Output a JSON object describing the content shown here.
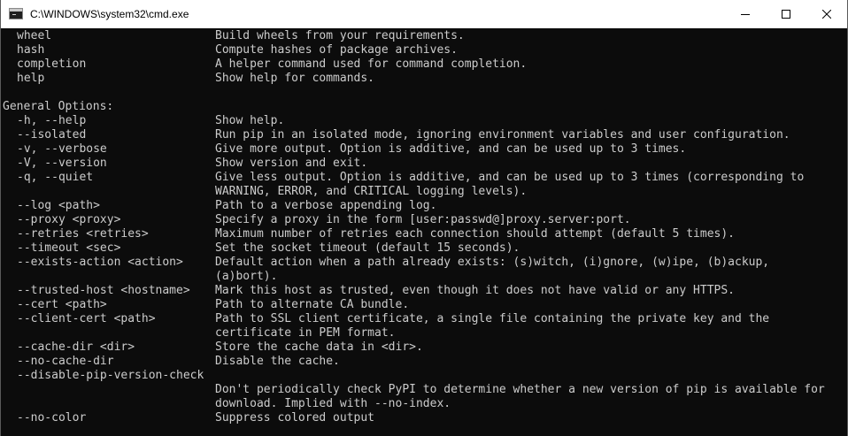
{
  "window": {
    "title": "C:\\WINDOWS\\system32\\cmd.exe",
    "icon": "console-icon",
    "minimize_icon": "minimize-icon",
    "maximize_icon": "maximize-icon",
    "close_icon": "close-icon"
  },
  "colors": {
    "console_bg": "#0c0c0c",
    "console_fg": "#cccccc",
    "titlebar_bg": "#ffffff"
  },
  "console": {
    "commands": [
      {
        "name": "wheel",
        "desc": "Build wheels from your requirements."
      },
      {
        "name": "hash",
        "desc": "Compute hashes of package archives."
      },
      {
        "name": "completion",
        "desc": "A helper command used for command completion."
      },
      {
        "name": "help",
        "desc": "Show help for commands."
      }
    ],
    "general_heading": "General Options:",
    "options": [
      {
        "opt": "-h, --help",
        "desc": [
          "Show help."
        ]
      },
      {
        "opt": "--isolated",
        "desc": [
          "Run pip in an isolated mode, ignoring environment variables and user configuration."
        ]
      },
      {
        "opt": "-v, --verbose",
        "desc": [
          "Give more output. Option is additive, and can be used up to 3 times."
        ]
      },
      {
        "opt": "-V, --version",
        "desc": [
          "Show version and exit."
        ]
      },
      {
        "opt": "-q, --quiet",
        "desc": [
          "Give less output. Option is additive, and can be used up to 3 times (corresponding to",
          "WARNING, ERROR, and CRITICAL logging levels)."
        ]
      },
      {
        "opt": "--log <path>",
        "desc": [
          "Path to a verbose appending log."
        ]
      },
      {
        "opt": "--proxy <proxy>",
        "desc": [
          "Specify a proxy in the form [user:passwd@]proxy.server:port."
        ]
      },
      {
        "opt": "--retries <retries>",
        "desc": [
          "Maximum number of retries each connection should attempt (default 5 times)."
        ]
      },
      {
        "opt": "--timeout <sec>",
        "desc": [
          "Set the socket timeout (default 15 seconds)."
        ]
      },
      {
        "opt": "--exists-action <action>",
        "desc": [
          "Default action when a path already exists: (s)witch, (i)gnore, (w)ipe, (b)ackup,",
          "(a)bort)."
        ]
      },
      {
        "opt": "--trusted-host <hostname>",
        "desc": [
          "Mark this host as trusted, even though it does not have valid or any HTTPS."
        ]
      },
      {
        "opt": "--cert <path>",
        "desc": [
          "Path to alternate CA bundle."
        ]
      },
      {
        "opt": "--client-cert <path>",
        "desc": [
          "Path to SSL client certificate, a single file containing the private key and the",
          "certificate in PEM format."
        ]
      },
      {
        "opt": "--cache-dir <dir>",
        "desc": [
          "Store the cache data in <dir>."
        ]
      },
      {
        "opt": "--no-cache-dir",
        "desc": [
          "Disable the cache."
        ]
      },
      {
        "opt": "--disable-pip-version-check",
        "desc": []
      },
      {
        "opt": "",
        "desc": [
          "Don't periodically check PyPI to determine whether a new version of pip is available for",
          "download. Implied with --no-index."
        ]
      },
      {
        "opt": "--no-color",
        "desc": [
          "Suppress colored output"
        ]
      }
    ]
  }
}
